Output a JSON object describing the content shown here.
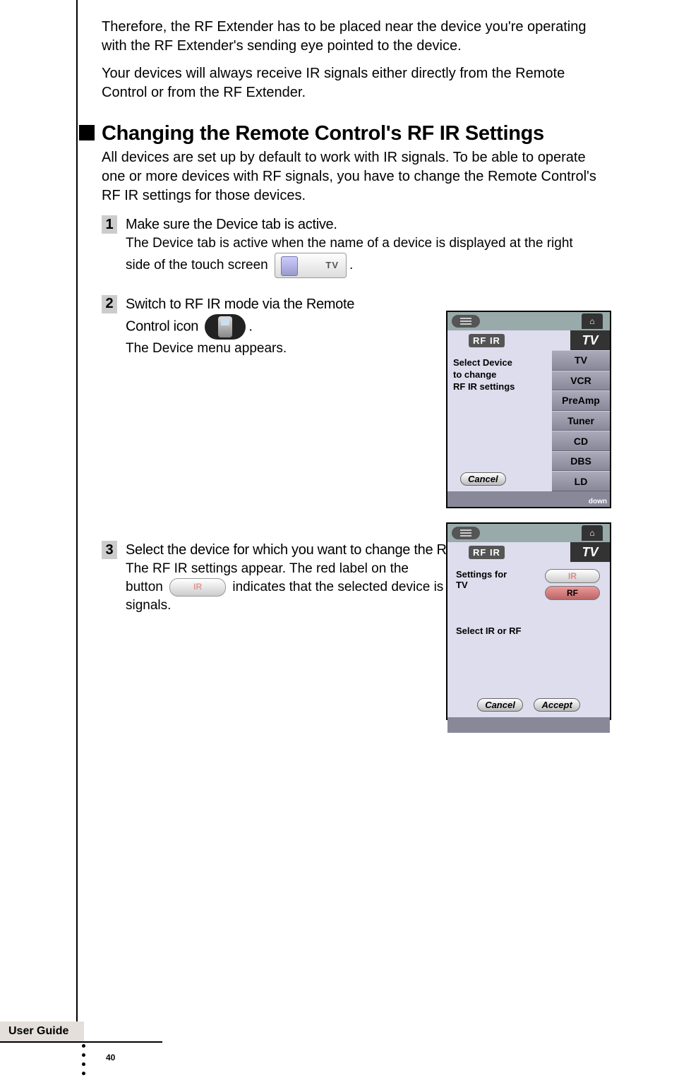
{
  "intro": {
    "p1": "Therefore, the RF Extender has to be placed near the device you're operating with the RF Extender's sending eye pointed to the device.",
    "p2": "Your devices will always receive IR signals either directly from the Remote Control or from the RF Extender."
  },
  "heading": "Changing the Remote Control's RF IR Settings",
  "heading_intro": "All devices are set up by default to work with IR signals. To be able to operate one or more devices with RF signals, you have to change the Remote Control's RF IR settings for those devices.",
  "steps": {
    "s1": {
      "num": "1",
      "lead": "Make sure the Device tab is active.",
      "sub_a": "The Device tab is active when the name of a device is displayed at the right",
      "sub_b": "side of the touch screen",
      "sub_c": "."
    },
    "s2": {
      "num": "2",
      "lead_a": "Switch to RF IR mode via the Remote",
      "lead_b": "Control icon",
      "lead_c": ".",
      "sub": "The Device menu appears."
    },
    "s3": {
      "num": "3",
      "lead": "Select the device for which you want to change the RF IR settings.",
      "sub_a": "The RF IR settings appear. The red label on the",
      "sub_b": "button",
      "sub_c": "indicates that the selected device is currently operated with IR signals."
    }
  },
  "fig1": {
    "rf_tag": "RF IR",
    "tv_tab": "TV",
    "left": {
      "l1": "Select Device",
      "l2": "to change",
      "l3": "RF IR settings"
    },
    "devices": [
      "TV",
      "VCR",
      "PreAmp",
      "Tuner",
      "CD",
      "DBS",
      "LD"
    ],
    "cancel": "Cancel",
    "down": "down",
    "home": "⌂"
  },
  "fig2": {
    "rf_tag": "RF IR",
    "tv_tab": "TV",
    "settings_for": "Settings for",
    "device": "TV",
    "select": "Select IR or RF",
    "ir": "IR",
    "rf": "RF",
    "cancel": "Cancel",
    "accept": "Accept",
    "home": "⌂"
  },
  "footer": {
    "label": "User Guide",
    "page": "40"
  }
}
